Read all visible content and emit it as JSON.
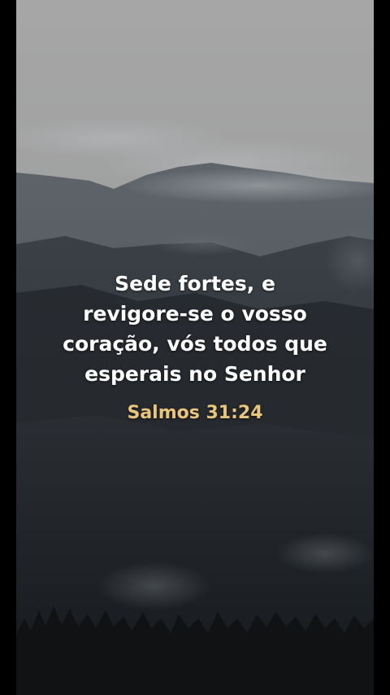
{
  "verse": {
    "lines": [
      "Sede fortes, e",
      "revigore-se o vosso",
      "coração, vós todos que",
      "esperais no Senhor"
    ],
    "reference": "Salmos 31:24"
  },
  "colors": {
    "text": "#ffffff",
    "reference": "#e8c57a",
    "sky": "#a7a7a7",
    "mountains_dark": "#23272c"
  },
  "background": "misty mountain forest landscape"
}
